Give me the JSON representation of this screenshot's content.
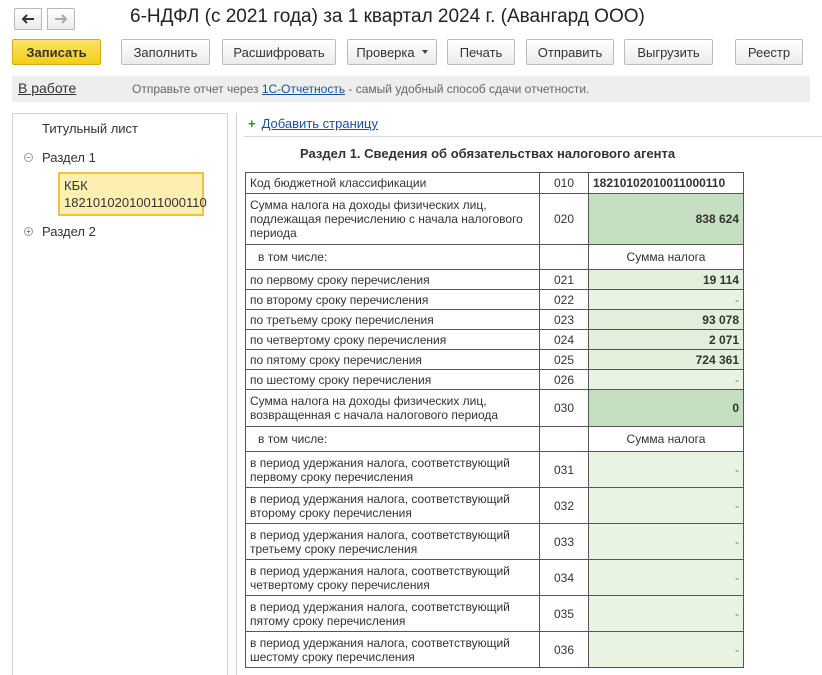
{
  "window": {
    "title": "6-НДФЛ (с 2021 года) за 1 квартал 2024 г. (Авангард ООО)"
  },
  "toolbar": {
    "save": "Записать",
    "fill": "Заполнить",
    "decode": "Расшифровать",
    "check": "Проверка",
    "print": "Печать",
    "send": "Отправить",
    "export": "Выгрузить",
    "registry": "Реестр"
  },
  "status": {
    "state": "В работе",
    "hint_prefix": "Отправьте отчет через ",
    "hint_link": "1С-Отчетность",
    "hint_suffix": " - самый удобный способ сдачи отчетности."
  },
  "tree": {
    "title_page": "Титульный лист",
    "section1": "Раздел 1",
    "kbk_label": "КБК",
    "kbk_value": "18210102010011000110",
    "section2": "Раздел 2"
  },
  "form": {
    "add_page": "Добавить страницу",
    "section_title": "Раздел 1. Сведения об обязательствах налогового агента",
    "kbk_row": {
      "label": "Код бюджетной классификации",
      "code": "010",
      "value": "18210102010011000110"
    },
    "row020": {
      "label": "Сумма налога на доходы физических лиц, подлежащая перечислению с начала налогового периода",
      "code": "020",
      "value": "838 624"
    },
    "sub_header1": {
      "label": "в том числе:",
      "column": "Сумма налога"
    },
    "terms": [
      {
        "label": "по первому сроку перечисления",
        "code": "021",
        "value": "19 114"
      },
      {
        "label": "по второму сроку перечисления",
        "code": "022",
        "value": "-"
      },
      {
        "label": "по третьему сроку перечисления",
        "code": "023",
        "value": "93 078"
      },
      {
        "label": "по четвертому сроку перечисления",
        "code": "024",
        "value": "2 071"
      },
      {
        "label": "по пятому сроку перечисления",
        "code": "025",
        "value": "724 361"
      },
      {
        "label": "по шестому сроку перечисления",
        "code": "026",
        "value": "-"
      }
    ],
    "row030": {
      "label": "Сумма налога на доходы физических лиц, возвращенная с начала налогового периода",
      "code": "030",
      "value": "0"
    },
    "sub_header2": {
      "label": "в том числе:",
      "column": "Сумма налога"
    },
    "returns": [
      {
        "label": "в период удержания налога, соответствующий первому сроку перечисления",
        "code": "031",
        "value": "-"
      },
      {
        "label": "в период удержания налога, соответствующий второму сроку перечисления",
        "code": "032",
        "value": "-"
      },
      {
        "label": "в период удержания налога, соответствующий третьему сроку перечисления",
        "code": "033",
        "value": "-"
      },
      {
        "label": "в период удержания налога, соответствующий четвертому сроку перечисления",
        "code": "034",
        "value": "-"
      },
      {
        "label": "в период удержания налога, соответствующий пятому сроку перечисления",
        "code": "035",
        "value": "-"
      },
      {
        "label": "в период удержания налога, соответствующий шестому сроку перечисления",
        "code": "036",
        "value": "-"
      }
    ]
  },
  "colors": {
    "primary_button": "#f2cd16",
    "cell_green": "#e2efda",
    "cell_green_dark": "#c6dfc2",
    "link": "#1a4f9c",
    "selection": "#fdefb2"
  }
}
